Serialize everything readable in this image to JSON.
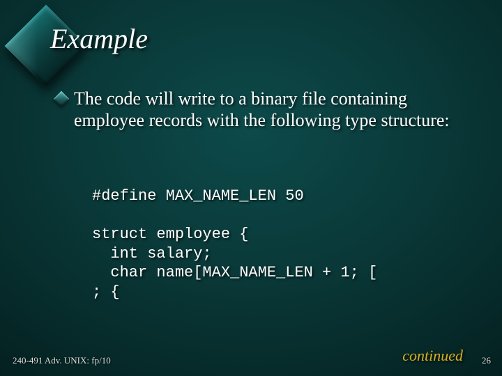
{
  "title": "Example",
  "bullet": "The code will write to a binary file containing employee records with the following type structure:",
  "code": "#define MAX_NAME_LEN 50\n\nstruct employee {\n  int salary;\n  char name[MAX_NAME_LEN + 1; [\n; {",
  "continued": "continued",
  "footer": "240-491 Adv. UNIX: fp/10",
  "page": "26"
}
